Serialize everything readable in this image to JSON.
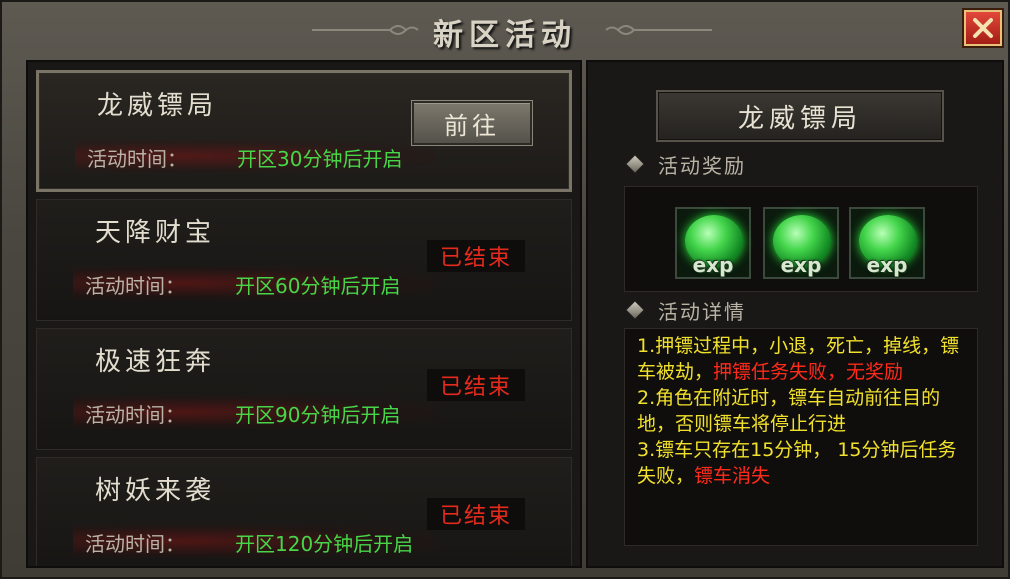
{
  "window": {
    "title": "新区活动",
    "close_icon": "close-x-icon"
  },
  "events": [
    {
      "name": "龙威镖局",
      "time_label": "活动时间：",
      "time_value": "开区30分钟后开启",
      "action": "前往",
      "status": "open",
      "selected": true
    },
    {
      "name": "天降财宝",
      "time_label": "活动时间：",
      "time_value": "开区60分钟后开启",
      "action": "已结束",
      "status": "ended",
      "selected": false
    },
    {
      "name": "极速狂奔",
      "time_label": "活动时间：",
      "time_value": "开区90分钟后开启",
      "action": "已结束",
      "status": "ended",
      "selected": false
    },
    {
      "name": "树妖来袭",
      "time_label": "活动时间：",
      "time_value": "开区120分钟后开启",
      "action": "已结束",
      "status": "ended",
      "selected": false
    }
  ],
  "detail": {
    "title": "龙威镖局",
    "rewards_label": "活动奖励",
    "rewards": [
      {
        "label": "exp",
        "icon": "exp-orb-icon"
      },
      {
        "label": "exp",
        "icon": "exp-orb-icon"
      },
      {
        "label": "exp",
        "icon": "exp-orb-icon"
      }
    ],
    "details_label": "活动详情",
    "text": {
      "p1": "1.押镖过程中，小退，死亡，掉线，镖车被劫，",
      "p1_red": "押镖任务失败，无奖励",
      "p2": "2.角色在附近时，镖车自动前往目的地，否则镖车将停止行进",
      "p3": "3.镖车只存在15分钟， 15分钟后任务失败，",
      "p3_red": "镖车消失"
    }
  },
  "colors": {
    "time_value": "#46d648",
    "ended": "#e62a1c",
    "detail_text": "#f2e12b",
    "detail_highlight": "#ff2a1a"
  }
}
